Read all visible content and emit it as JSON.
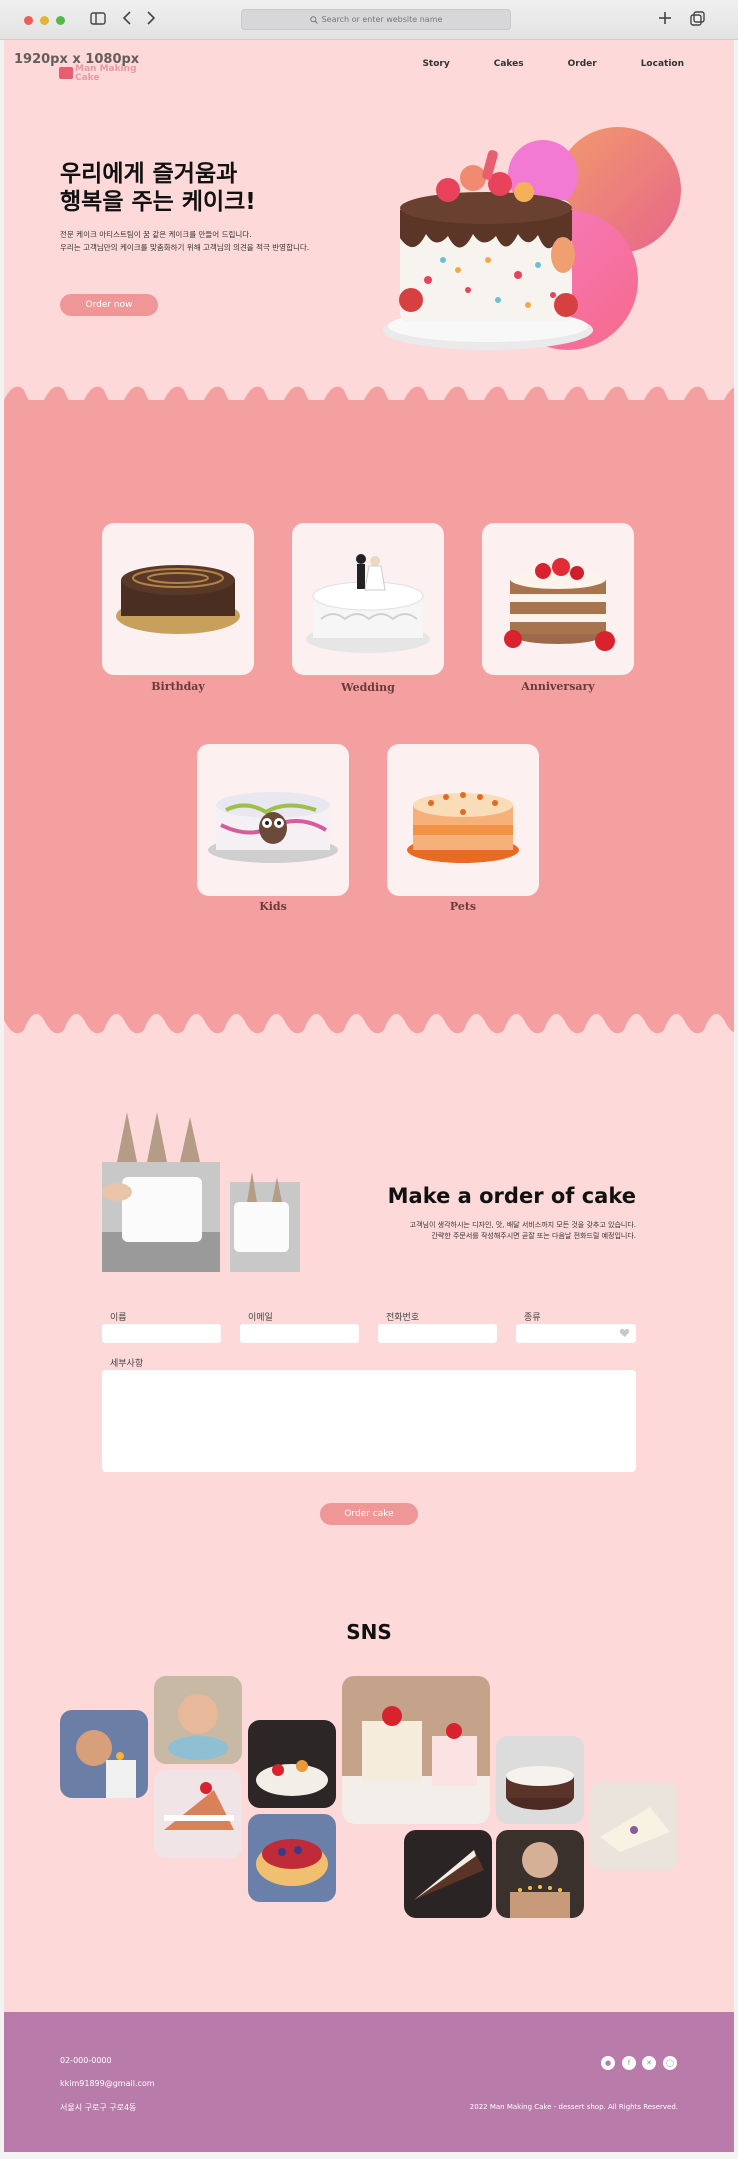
{
  "browser": {
    "address_placeholder": "Search or enter website name",
    "colors": {
      "close": "#ec5f58",
      "minimize": "#e3b434",
      "maximize": "#56b84a"
    }
  },
  "page": {
    "size_label": "1920px x 1080px",
    "logo_text": "Man Making Cake",
    "nav": [
      "Story",
      "Cakes",
      "Order",
      "Location"
    ],
    "hero": {
      "title_line1": "우리에게 즐거움과",
      "title_line2": "행복을 주는 케이크!",
      "desc_line1": "전문 케이크 아티스트팀이 꿈 같은 케이크를 만들어 드립니다.",
      "desc_line2": "우리는 고객님만의 케이크를 맞춤화하기 위해 고객님의 의견을 적극 반영합니다.",
      "button": "Order now"
    },
    "categories": [
      {
        "label": "Birthday",
        "icon": "chocolate-cake-icon"
      },
      {
        "label": "Wedding",
        "icon": "wedding-cake-icon"
      },
      {
        "label": "Anniversary",
        "icon": "strawberry-layer-cake-icon"
      },
      {
        "label": "Kids",
        "icon": "owl-cake-icon"
      },
      {
        "label": "Pets",
        "icon": "orange-cake-icon"
      }
    ],
    "order": {
      "title": "Make a order of cake",
      "desc_line1": "고객님이 생각하시는 디자인, 맛, 배달 서비스까지 모든 것을 갖추고 있습니다.",
      "desc_line2": "간략한 주문서를 작성해주시면 곧잘 또는 다음날 전화드릴 예정입니다.",
      "fields": {
        "name": "이름",
        "email": "이메일",
        "phone": "전화번호",
        "type": "종류",
        "detail": "세부사항"
      },
      "button": "Order cake"
    },
    "sns_title": "SNS",
    "footer": {
      "phone": "02-000-0000",
      "email": "kkim91899@gmail.com",
      "address": "서울시 구로구 구로4동",
      "copyright": "2022 Man Making Cake - dessert shop. All Rights Reserved."
    }
  }
}
